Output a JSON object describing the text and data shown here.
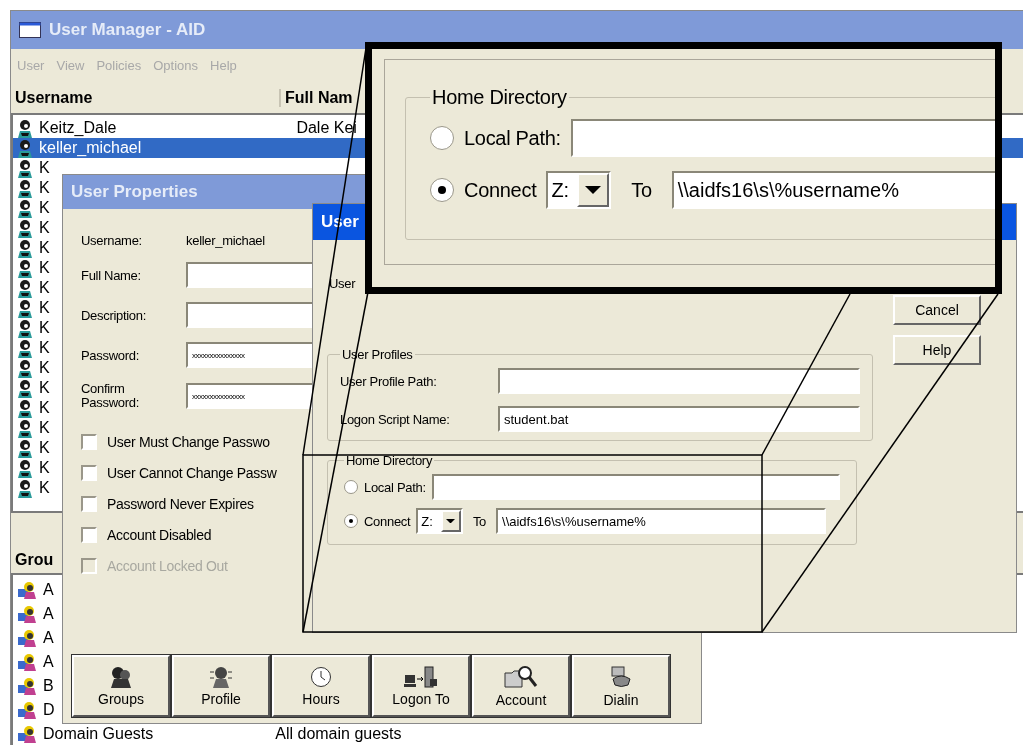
{
  "main_window": {
    "title": "User Manager - AID",
    "menu": {
      "disabled": true,
      "items": [
        "User",
        "View",
        "Policies",
        "Options",
        "Help"
      ]
    },
    "columns": [
      "Username",
      "Full Nam"
    ],
    "users": [
      {
        "username": "Keitz_Dale",
        "full_name": "Dale Kei",
        "selected": false
      },
      {
        "username": "keller_michael",
        "selected": true
      },
      {
        "username": "K",
        "selected": false
      },
      {
        "username": "K",
        "selected": false
      },
      {
        "username": "K",
        "selected": false
      },
      {
        "username": "K",
        "selected": false
      },
      {
        "username": "K",
        "selected": false
      },
      {
        "username": "K",
        "selected": false
      },
      {
        "username": "K",
        "selected": false
      },
      {
        "username": "K",
        "selected": false
      },
      {
        "username": "K",
        "selected": false
      },
      {
        "username": "K",
        "selected": false
      },
      {
        "username": "K",
        "selected": false
      },
      {
        "username": "K",
        "selected": false
      },
      {
        "username": "K",
        "selected": false
      },
      {
        "username": "K",
        "selected": false
      },
      {
        "username": "K",
        "selected": false
      },
      {
        "username": "K",
        "selected": false
      },
      {
        "username": "K",
        "selected": false
      }
    ],
    "groups_header": "Grou",
    "groups": [
      {
        "name": "A"
      },
      {
        "name": "A"
      },
      {
        "name": "A"
      },
      {
        "name": "A"
      },
      {
        "name": "B"
      },
      {
        "name": "D"
      },
      {
        "name": "Domain Guests",
        "description": "All domain guests"
      }
    ]
  },
  "user_properties": {
    "title": "User Properties",
    "username_label": "Username:",
    "username": "keller_michael",
    "fields": [
      {
        "label": "Full Name:"
      },
      {
        "label": "Description:"
      },
      {
        "label": "Password:",
        "value": "xxxxxxxxxxxxxxx"
      },
      {
        "label": "Confirm Password:",
        "value": "xxxxxxxxxxxxxxx"
      }
    ],
    "checkboxes": [
      {
        "label": "User Must Change Passwo",
        "checked": false,
        "disabled": false
      },
      {
        "label": "User Cannot Change Passw",
        "checked": false,
        "disabled": false
      },
      {
        "label": "Password Never Expires",
        "checked": false,
        "disabled": false
      },
      {
        "label": "Account Disabled",
        "checked": false,
        "disabled": false
      },
      {
        "label": "Account Locked Out",
        "checked": false,
        "disabled": true
      }
    ],
    "buttons": [
      {
        "kind": "groups",
        "label": "Groups"
      },
      {
        "kind": "profile",
        "label": "Profile"
      },
      {
        "kind": "hours",
        "label": "Hours"
      },
      {
        "kind": "logon",
        "label": "Logon To"
      },
      {
        "kind": "account",
        "label": "Account"
      },
      {
        "kind": "dialin",
        "label": "Dialin"
      }
    ]
  },
  "profile_dialog": {
    "title": "User",
    "caption": "User",
    "buttons": [
      "Cancel",
      "Help"
    ],
    "user_profiles": {
      "title": "User Profiles",
      "profile_path_label": "User Profile Path:",
      "logon_script_label": "Logon Script Name:",
      "logon_script": "student.bat"
    },
    "home_directory": {
      "title": "Home Directory",
      "options": [
        {
          "label": "Local Path:",
          "selected": false
        },
        {
          "label": "Connect",
          "selected": true
        }
      ],
      "drive": "Z:",
      "to_label": "To",
      "path": "\\\\aidfs16\\s\\%username%"
    }
  },
  "callout": {
    "home_directory": {
      "title": "Home Directory",
      "options": [
        {
          "label": "Local Path:",
          "selected": false
        },
        {
          "label": "Connect",
          "selected": true
        }
      ],
      "drive": "Z:",
      "to_label": "To",
      "path": "\\\\aidfs16\\s\\%username%"
    }
  }
}
